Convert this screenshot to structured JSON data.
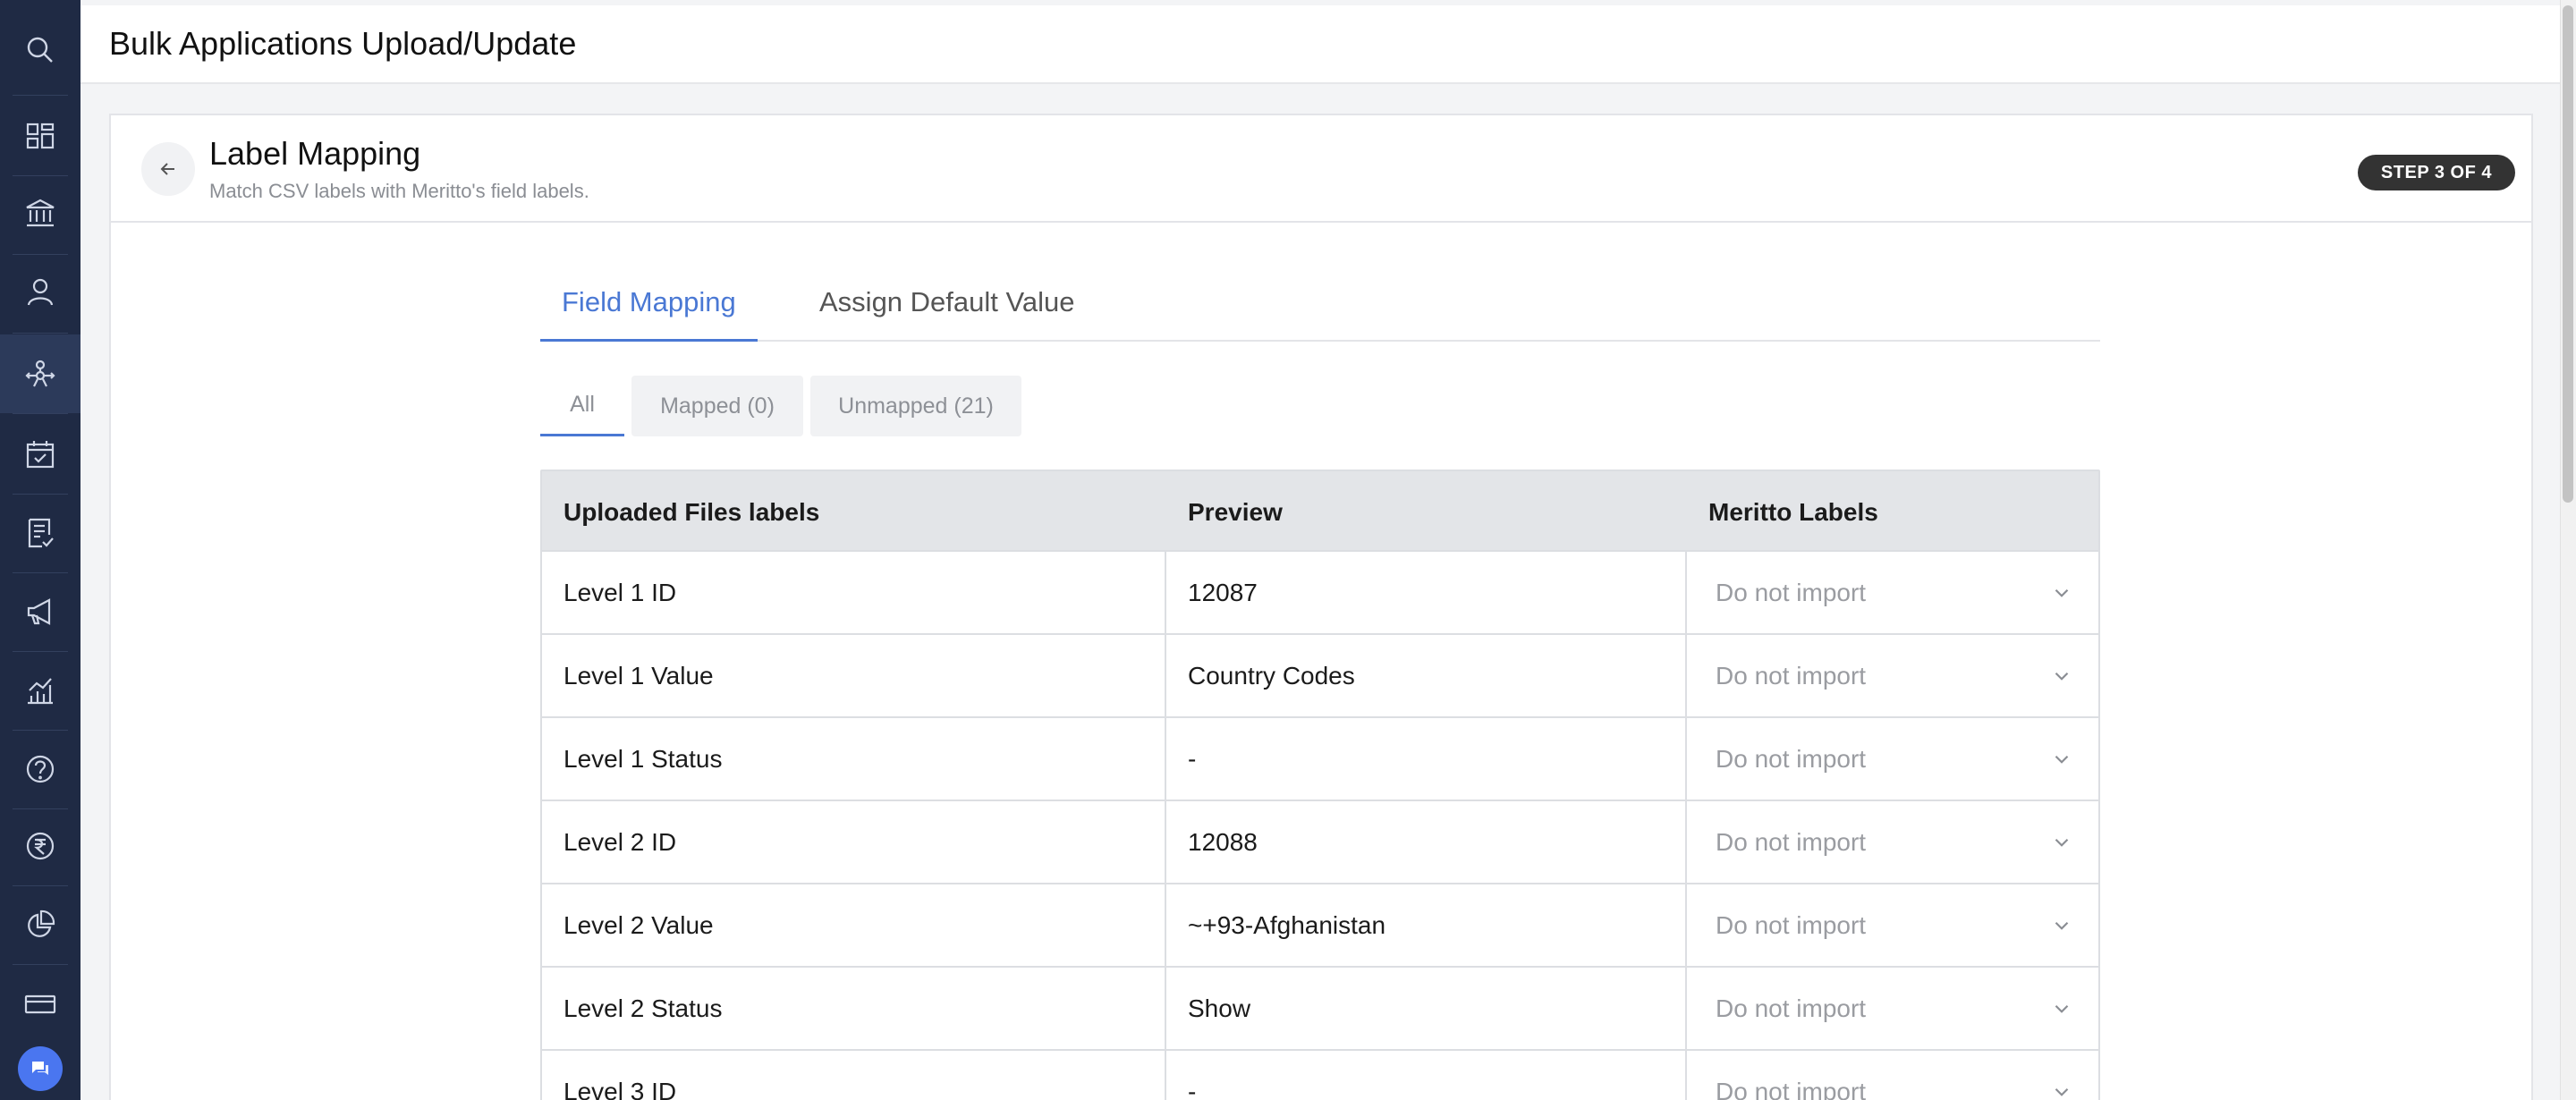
{
  "header": {
    "title": "Bulk Applications Upload/Update"
  },
  "sidebar": {
    "icons": [
      "search-icon",
      "dashboard-icon",
      "institution-icon",
      "user-icon",
      "network-icon",
      "calendar-check-icon",
      "checklist-icon",
      "megaphone-icon",
      "analytics-icon",
      "help-icon",
      "rupee-icon",
      "pie-chart-icon",
      "card-icon"
    ],
    "active": "network-icon",
    "chat_icon": "chat-icon"
  },
  "card": {
    "title": "Label Mapping",
    "subtitle": "Match CSV labels with Meritto's field labels.",
    "step": "STEP 3 OF 4"
  },
  "tabs": [
    {
      "label": "Field Mapping",
      "active": true
    },
    {
      "label": "Assign Default Value",
      "active": false
    }
  ],
  "filters": [
    {
      "label": "All",
      "active": true
    },
    {
      "label": "Mapped (0)",
      "active": false
    },
    {
      "label": "Unmapped (21)",
      "active": false
    }
  ],
  "table": {
    "columns": [
      "Uploaded Files labels",
      "Preview",
      "Meritto Labels"
    ],
    "rows": [
      {
        "label": "Level 1 ID",
        "preview": "12087",
        "mapping": "Do not import"
      },
      {
        "label": "Level 1 Value",
        "preview": "Country Codes",
        "mapping": "Do not import"
      },
      {
        "label": "Level 1 Status",
        "preview": "-",
        "mapping": "Do not import"
      },
      {
        "label": "Level 2 ID",
        "preview": "12088",
        "mapping": "Do not import"
      },
      {
        "label": "Level 2 Value",
        "preview": "~+93-Afghanistan",
        "mapping": "Do not import"
      },
      {
        "label": "Level 2 Status",
        "preview": "Show",
        "mapping": "Do not import"
      },
      {
        "label": "Level 3 ID",
        "preview": "-",
        "mapping": "Do not import"
      }
    ]
  },
  "colors": {
    "accent": "#4a78d4",
    "sidebar": "#1f2a44",
    "badge": "#333333"
  }
}
